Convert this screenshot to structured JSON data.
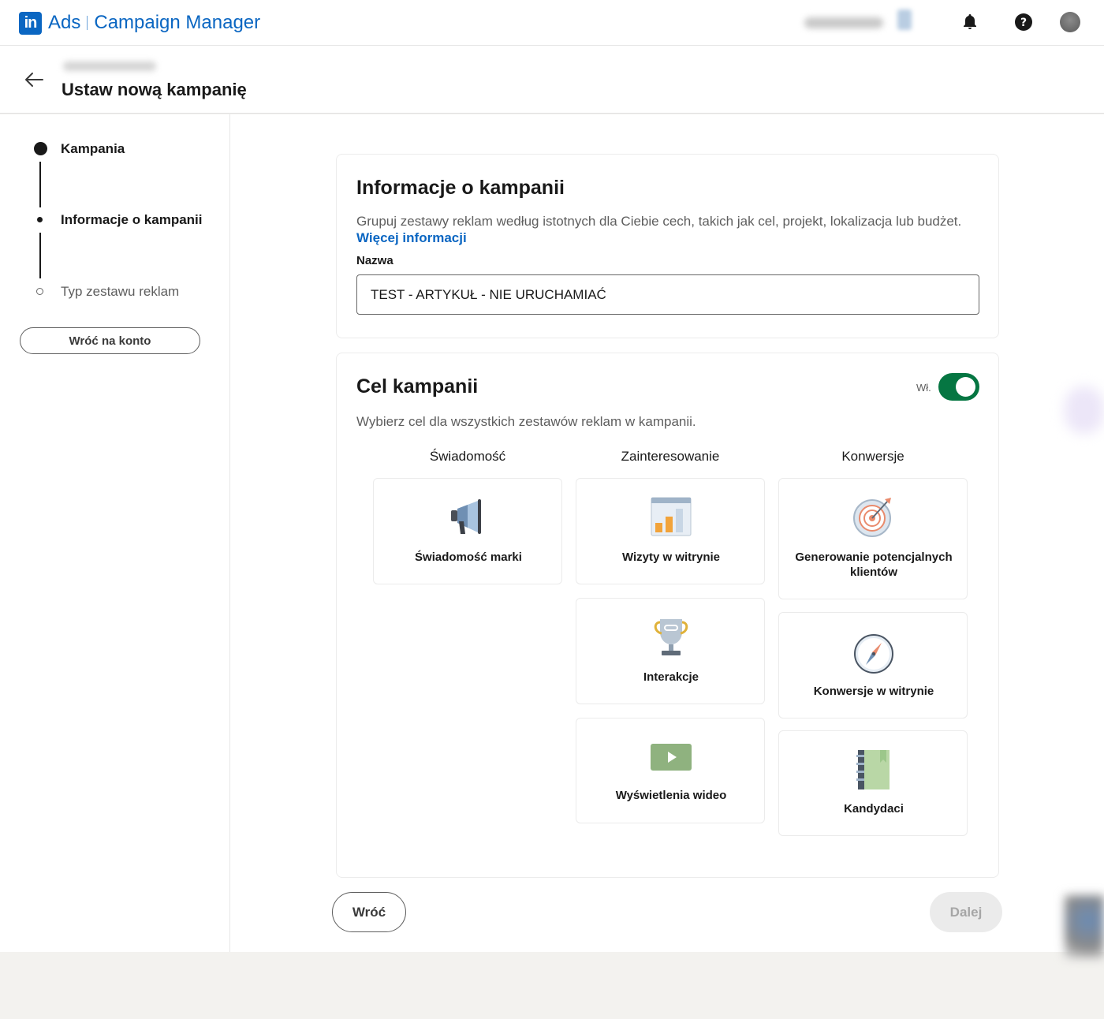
{
  "header": {
    "logo_text": "in",
    "brand_ads": "Ads",
    "brand_name": "Campaign Manager"
  },
  "subheader": {
    "title": "Ustaw nową kampanię"
  },
  "steps": [
    {
      "label": "Kampania"
    },
    {
      "label": "Informacje o kampanii"
    },
    {
      "label": "Typ zestawu reklam"
    }
  ],
  "left_button": "Wróć na konto",
  "info_card": {
    "title": "Informacje o kampanii",
    "description": "Grupuj zestawy reklam według istotnych dla Ciebie cech, takich jak cel, projekt, lokalizacja lub budżet.",
    "more_link": "Więcej informacji",
    "field_label": "Nazwa",
    "field_value": "TEST - ARTYKUŁ - NIE URUCHAMIAĆ"
  },
  "objective_card": {
    "title": "Cel kampanii",
    "toggle_label": "Wł.",
    "description": "Wybierz cel dla wszystkich zestawów reklam w kampanii.",
    "columns": [
      "Świadomość",
      "Zainteresowanie",
      "Konwersje"
    ],
    "tiles": {
      "brand_awareness": {
        "label": "Świadomość marki",
        "icon": "megaphone-icon"
      },
      "website_visits": {
        "label": "Wizyty w witrynie",
        "icon": "bar-chart-icon"
      },
      "engagement": {
        "label": "Interakcje",
        "icon": "trophy-icon"
      },
      "video_views": {
        "label": "Wyświetlenia wideo",
        "icon": "video-play-icon"
      },
      "lead_generation": {
        "label": "Generowanie potencjalnych klientów",
        "icon": "target-icon"
      },
      "website_conversions": {
        "label": "Konwersje w witrynie",
        "icon": "compass-icon"
      },
      "job_applicants": {
        "label": "Kandydaci",
        "icon": "notebook-icon"
      }
    }
  },
  "footer_buttons": {
    "back": "Wróć",
    "next": "Dalej"
  },
  "colors": {
    "brand_blue": "#0a66c2",
    "toggle_green": "#057642"
  }
}
